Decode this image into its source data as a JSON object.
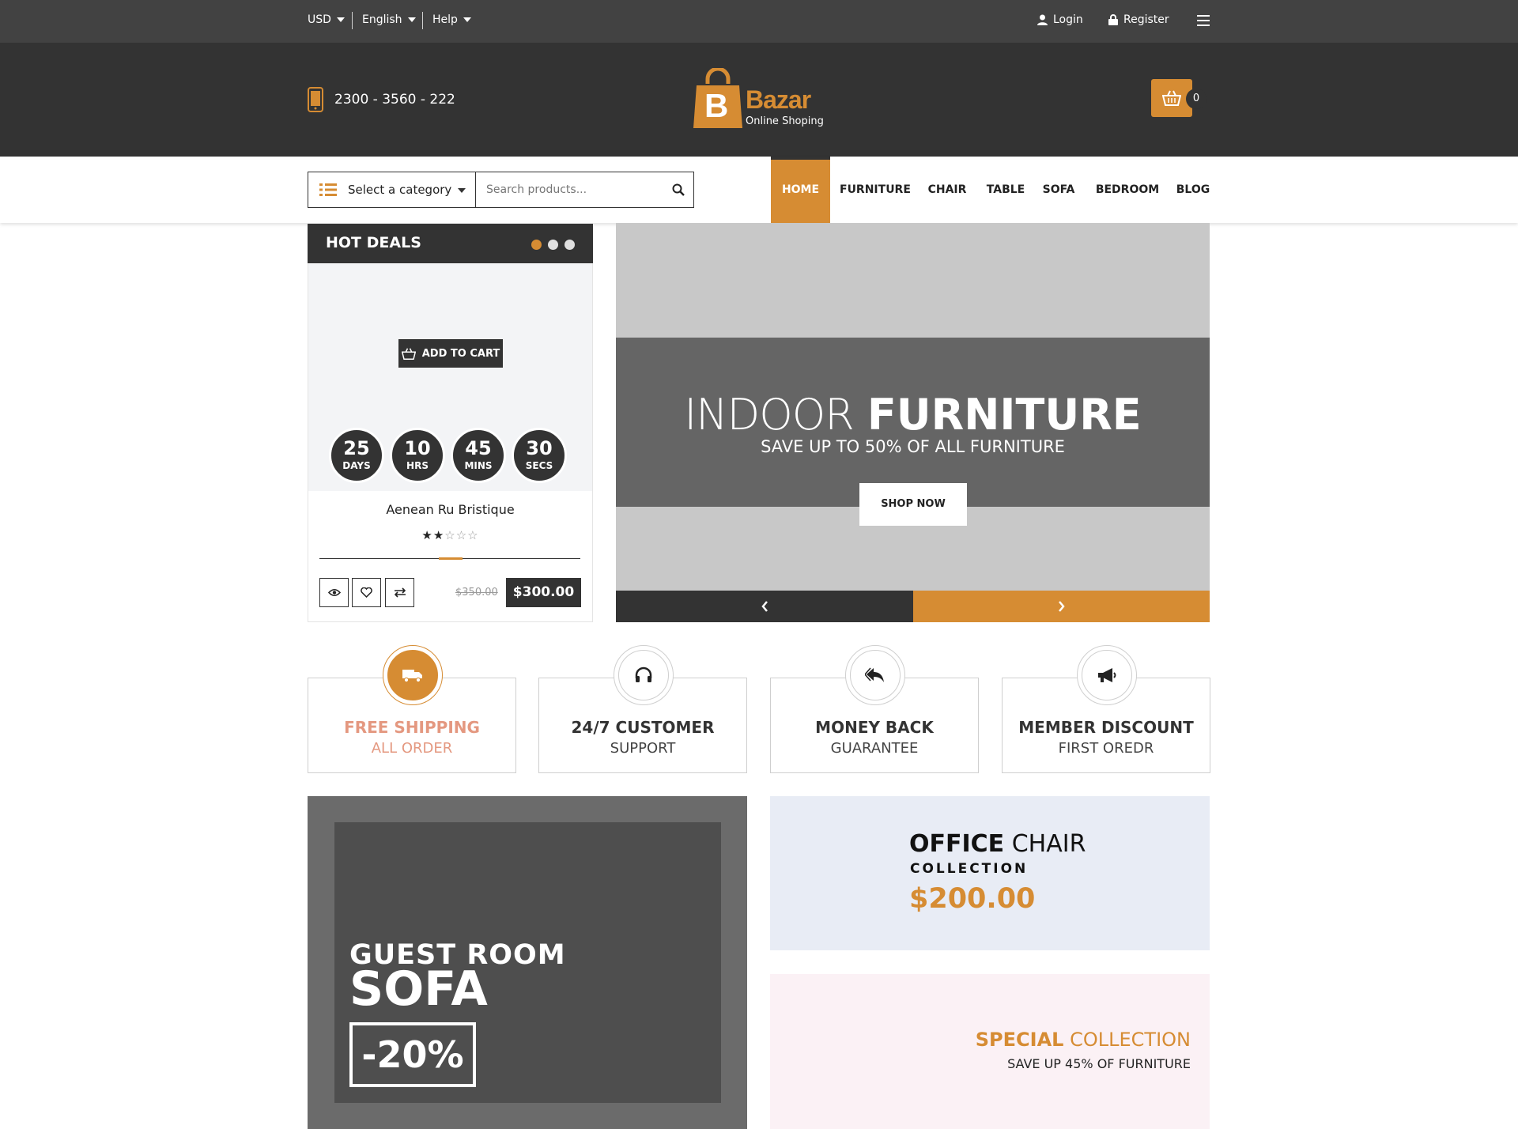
{
  "colors": {
    "accent": "#d68c33",
    "dark": "#333333",
    "topbar": "#424242"
  },
  "topbar": {
    "currency": "USD",
    "language": "English",
    "help": "Help",
    "login": "Login",
    "register": "Register"
  },
  "header": {
    "phone": "2300 - 3560 - 222",
    "logo_letter": "B",
    "logo_name": "Bazar",
    "logo_tagline": "Online Shoping",
    "cart_count": "0"
  },
  "search": {
    "category_label": "Select a category",
    "placeholder": "Search products..."
  },
  "nav": {
    "items": [
      {
        "label": "HOME"
      },
      {
        "label": "FURNITURE"
      },
      {
        "label": "CHAIR"
      },
      {
        "label": "TABLE"
      },
      {
        "label": "SOFA"
      },
      {
        "label": "BEDROOM"
      },
      {
        "label": "BLOG"
      }
    ]
  },
  "hot_deals": {
    "title": "HOT DEALS",
    "add_to_cart": "ADD TO CART",
    "timer": [
      {
        "value": "25",
        "unit": "DAYS"
      },
      {
        "value": "10",
        "unit": "HRS"
      },
      {
        "value": "45",
        "unit": "MINS"
      },
      {
        "value": "30",
        "unit": "SECS"
      }
    ],
    "product_name": "Aenean Ru Bristique",
    "rating": 2,
    "rating_max": 5,
    "old_price": "$350.00",
    "price": "$300.00"
  },
  "slider": {
    "title_light": "INDOOR",
    "title_bold": "FURNITURE",
    "subtitle": "SAVE UP TO 50% OF ALL FURNITURE",
    "button": "SHOP NOW"
  },
  "features": [
    {
      "title": "FREE SHIPPING",
      "subtitle": "ALL ORDER",
      "icon": "truck-icon"
    },
    {
      "title": "24/7 CUSTOMER",
      "subtitle": "SUPPORT",
      "icon": "headphones-icon"
    },
    {
      "title": "MONEY BACK",
      "subtitle": "GUARANTEE",
      "icon": "reply-arrow-icon"
    },
    {
      "title": "MEMBER DISCOUNT",
      "subtitle": "FIRST OREDR",
      "icon": "megaphone-icon"
    }
  ],
  "banners": {
    "sofa": {
      "line1": "GUEST ROOM",
      "line2": "SOFA",
      "discount": "-20%"
    },
    "office": {
      "title_bold": "OFFICE",
      "title_light": "CHAIR",
      "subtitle": "COLLECTION",
      "price": "$200.00"
    },
    "special": {
      "title_bold": "SPECIAL",
      "title_light": "COLLECTION",
      "subtitle": "SAVE UP 45% OF FURNITURE"
    }
  }
}
